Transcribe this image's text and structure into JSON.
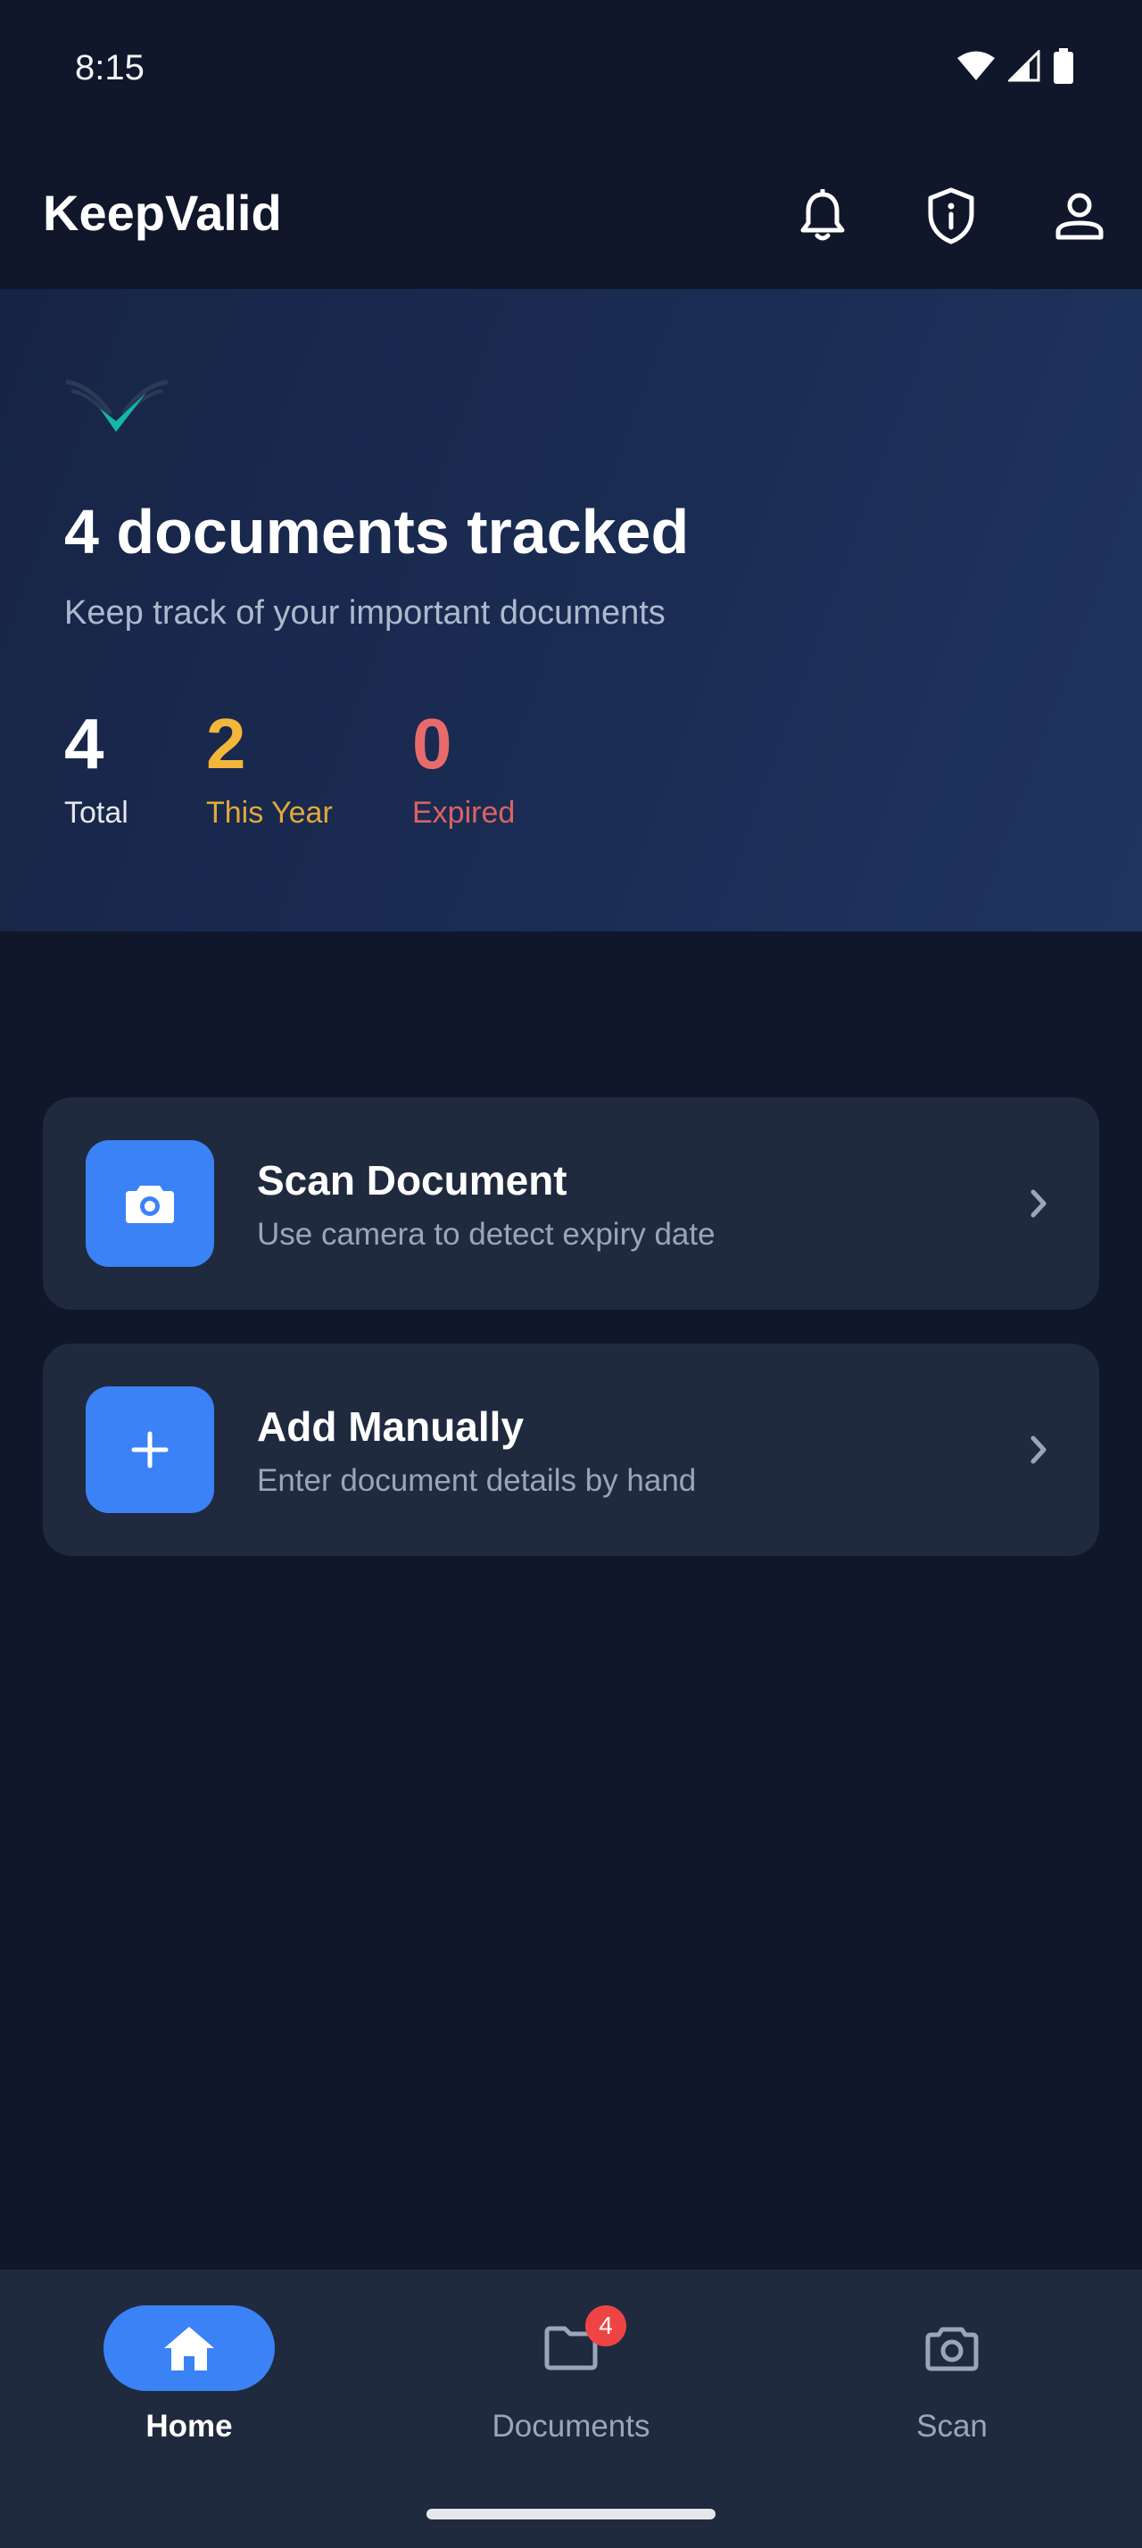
{
  "status_bar": {
    "time": "8:15"
  },
  "app_bar": {
    "title": "KeepValid",
    "icons": [
      "bell-icon",
      "shield-info-icon",
      "person-icon"
    ]
  },
  "hero": {
    "title": "4 documents tracked",
    "subtitle": "Keep track of your important documents",
    "stats": [
      {
        "value": "4",
        "label": "Total",
        "color": "#ffffff"
      },
      {
        "value": "2",
        "label": "This Year",
        "color": "#f2b73a"
      },
      {
        "value": "0",
        "label": "Expired",
        "color": "#e86b6b"
      }
    ]
  },
  "actions": [
    {
      "title": "Scan Document",
      "subtitle": "Use camera to detect expiry date",
      "icon": "camera-icon"
    },
    {
      "title": "Add Manually",
      "subtitle": "Enter document details by hand",
      "icon": "plus-icon"
    }
  ],
  "bottom_nav": {
    "items": [
      {
        "label": "Home",
        "icon": "home-icon",
        "active": true
      },
      {
        "label": "Documents",
        "icon": "folder-icon",
        "badge": "4"
      },
      {
        "label": "Scan",
        "icon": "camera-icon"
      }
    ]
  },
  "colors": {
    "background": "#10172a",
    "card": "#1f2a3e",
    "accent": "#3b82f6",
    "badge": "#ef4444"
  }
}
